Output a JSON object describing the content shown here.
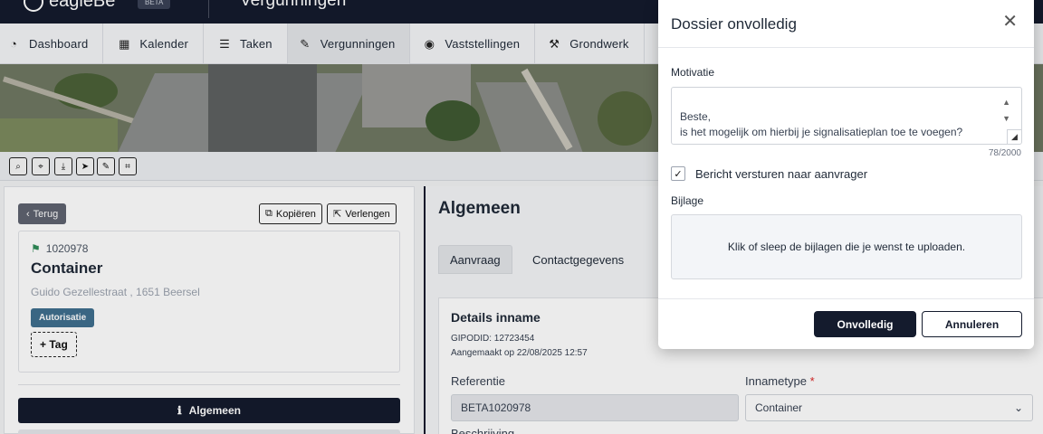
{
  "app": {
    "logo_text": "eagleBe",
    "beta": "BETA",
    "page_title": "Vergunningen"
  },
  "nav": {
    "items": [
      {
        "label": "Dashboard",
        "icon": "gauge-icon"
      },
      {
        "label": "Kalender",
        "icon": "calendar-icon"
      },
      {
        "label": "Taken",
        "icon": "checklist-icon"
      },
      {
        "label": "Vergunningen",
        "icon": "signature-icon"
      },
      {
        "label": "Vaststellingen",
        "icon": "eye-icon"
      },
      {
        "label": "Grondwerk",
        "icon": "digging-icon"
      }
    ]
  },
  "left": {
    "back_label": "Terug",
    "copy_label": "Kopiëren",
    "extend_label": "Verlengen",
    "dossier_id": "1020978",
    "title": "Container",
    "address": "Guido Gezellestraat , 1651 Beersel",
    "badge": "Autorisatie",
    "add_tag": "+ Tag",
    "section": "Algemeen"
  },
  "right": {
    "title": "Algemeen",
    "tabs": [
      "Aanvraag",
      "Contactgegevens"
    ],
    "details_title": "Details inname",
    "gipodid": "GIPODID: 12723454",
    "created": "Aangemaakt op 22/08/2025 12:57",
    "referentie_label": "Referentie",
    "referentie_value": "BETA1020978",
    "innametype_label": "Innametype",
    "required_mark": "*",
    "innametype_value": "Container",
    "beschrijving_label": "Beschrijving"
  },
  "modal": {
    "title": "Dossier onvolledig",
    "motivatie_label": "Motivatie",
    "motivatie_value": "Beste,\nis het mogelijk om hierbij je signalisatieplan toe te voegen?\nBedankt",
    "char_count": "78/2000",
    "checkbox_label": "Bericht versturen naar aanvrager",
    "checkbox_checked": true,
    "bijlage_label": "Bijlage",
    "dropzone_text": "Klik of sleep de bijlagen die je wenst te uploaden.",
    "confirm_label": "Onvolledig",
    "cancel_label": "Annuleren"
  }
}
